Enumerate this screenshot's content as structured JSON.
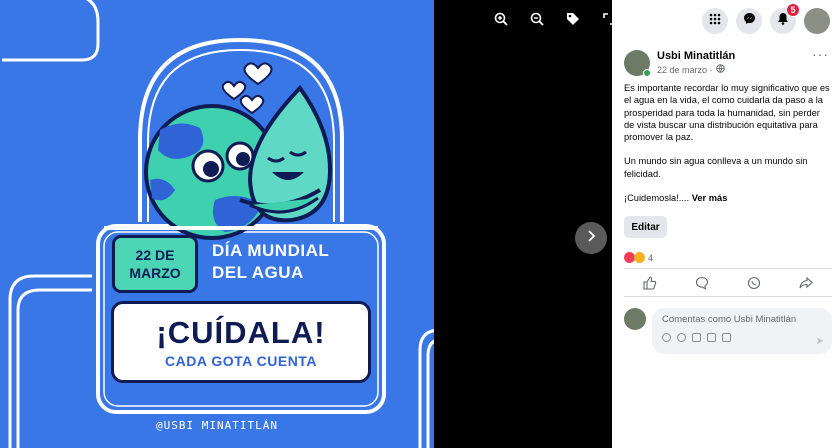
{
  "poster": {
    "date_line1": "22 DE",
    "date_line2": "MARZO",
    "title_line1": "DÍA MUNDIAL",
    "title_line2": "DEL AGUA",
    "headline": "¡CUÍDALA!",
    "subheadline": "CADA GOTA CUENTA",
    "handle": "@USBI MINATITLÁN",
    "colors": {
      "background": "#3a77e6",
      "teal": "#4bd5b5",
      "navy": "#0e1b54"
    }
  },
  "viewer_tools": [
    "zoom-in-icon",
    "zoom-out-icon",
    "tag-icon",
    "fullscreen-icon"
  ],
  "topnav": {
    "notification_count": "5"
  },
  "post": {
    "author": "Usbi Minatitlán",
    "date": "22 de marzo ·",
    "paragraph1": "Es importante recordar lo muy significativo que es el agua en la vida, el como cuidarla da paso a la prosperidad para toda la humanidad, sin perder de vista buscar una distribución equitativa para promover la paz.",
    "paragraph2": "Un mundo sin agua conlleva a un mundo sin felicidad.",
    "paragraph3": "¡Cuidemosla!....",
    "see_more": "Ver más",
    "edit_label": "Editar",
    "reaction_count": "4",
    "comment_placeholder": "Comentas como Usbi Minatitlán"
  }
}
